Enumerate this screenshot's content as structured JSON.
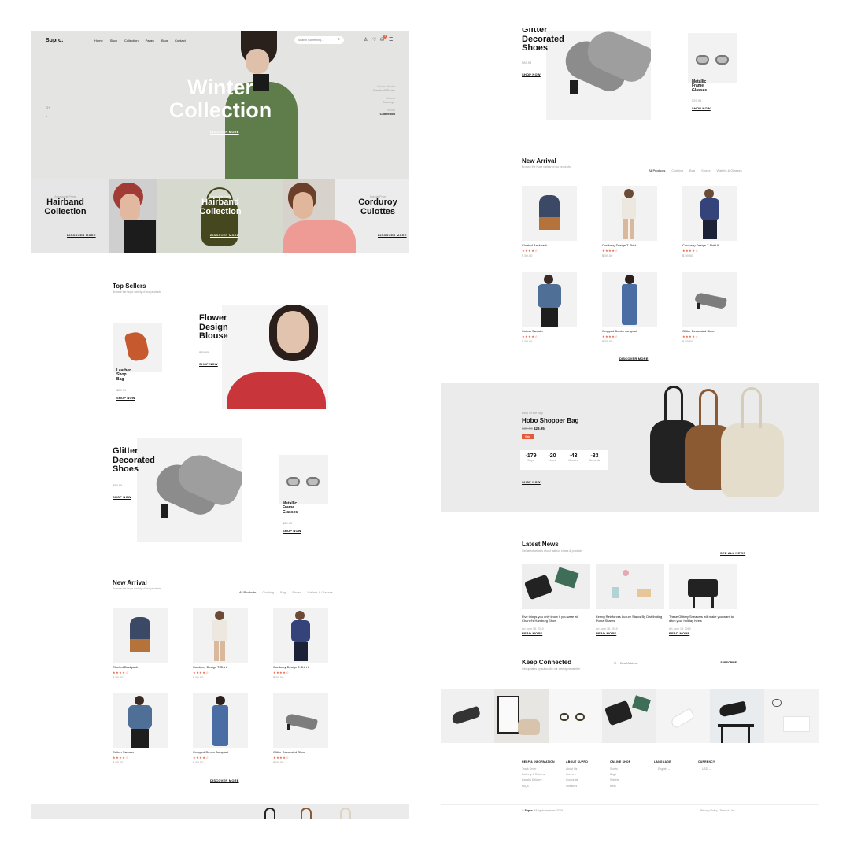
{
  "brand": "Supro.",
  "nav": [
    "Home",
    "Shop",
    "Collection",
    "Pages",
    "Blog",
    "Contact"
  ],
  "search": {
    "placeholder": "Search Something..."
  },
  "cart_count": "0",
  "colors": {
    "accent": "#e25a3a",
    "hero_bg": "#e4e5e3",
    "green_panel": "#d6d9cd",
    "banner_bg": "#ebebeb"
  },
  "hero": {
    "title_line1": "Winter",
    "title_line2": "Collection",
    "cta": "DISCOVER MORE",
    "side": [
      {
        "sub": "Autumn Winter",
        "main": "Baseball Shoes"
      },
      {
        "sub": "Casual",
        "main": "Goodbye"
      },
      {
        "sub": "Winter",
        "main": "Collection"
      }
    ],
    "socials": [
      "twitter-icon",
      "facebook-icon",
      "google-plus-icon",
      "pinterest-icon"
    ]
  },
  "promos": [
    {
      "tag": "Accessorie Prime",
      "line1": "Hairband",
      "line2": "Collection",
      "cta": "DISCOVER MORE"
    },
    {
      "tag": "Accessorie Prime",
      "line1": "Hairband",
      "line2": "Collection",
      "cta": "DISCOVER MORE"
    },
    {
      "tag": "Special Price",
      "line1": "Corduroy",
      "line2": "Culottes",
      "cta": "DISCOVER MORE"
    }
  ],
  "top_sellers": {
    "title": "Top Sellers",
    "sub": "Browse the huge variety of our products",
    "leather": {
      "l1": "Leather",
      "l2": "Shop",
      "l3": "Bag",
      "price": "$89.99",
      "cta": "SHOP NOW"
    },
    "flower": {
      "l1": "Flower",
      "l2": "Design",
      "l3": "Blouse",
      "price": "$89.95",
      "cta": "SHOP NOW"
    },
    "glitter": {
      "l1": "Glitter",
      "l2": "Decorated",
      "l3": "Shoes",
      "price": "$89.95",
      "cta": "SHOP NOW"
    },
    "metallic": {
      "l1": "Metallic",
      "l2": "Frame",
      "l3": "Glasses",
      "price": "$29.95",
      "cta": "SHOP NOW"
    }
  },
  "new_arrival": {
    "title": "New Arrival",
    "sub": "Browse the huge variety of our products",
    "tabs": [
      "All Products",
      "Clothing",
      "Bag",
      "Shoes",
      "Wallets & Glasses"
    ],
    "products": [
      {
        "name": "Clueted Backpack",
        "stars": "★★★★☆",
        "price": "$ 59.00"
      },
      {
        "name": "Corduroy Design T-Shirt",
        "stars": "★★★★☆",
        "price": "$ 59.00"
      },
      {
        "name": "Corduroy Design T-Shirt II",
        "stars": "★★★★☆",
        "price": "$ 59.00"
      },
      {
        "name": "Cotton Sweater",
        "stars": "★★★★☆",
        "price": "$ 59.00"
      },
      {
        "name": "Cropped Denim Jumpsuit",
        "stars": "★★★★☆",
        "price": "$ 59.00"
      },
      {
        "name": "Glitter Decorated Shoe",
        "stars": "★★★★☆",
        "price": "$ 59.00"
      }
    ],
    "cta": "DISCOVER MORE"
  },
  "deal": {
    "tag": "Deal of the day",
    "title": "Hobo Shopper Bag",
    "old_price": "$39.95",
    "price": "$29.95",
    "badge": "Sale",
    "countdown": [
      {
        "n": "-179",
        "l": "Days"
      },
      {
        "n": "-20",
        "l": "Hours"
      },
      {
        "n": "-43",
        "l": "Minutes"
      },
      {
        "n": "-33",
        "l": "Seconds"
      }
    ],
    "cta": "SHOP NOW"
  },
  "news": {
    "title": "Latest News",
    "sub": "Get latest articles about fashion shoes & products",
    "see_all": "SEE ALL NEWS",
    "items": [
      {
        "title": "Five things you only know if you were at Chanel's Hamburg Show",
        "date": "Art   June 18, 2019",
        "cta": "READ MORE"
      },
      {
        "title": "Kering Reinforces Luxury Status By Distributing Puma Shares",
        "date": "Art   June 18, 2019",
        "cta": "READ MORE"
      },
      {
        "title": "These Glittery Sneakers will make you want to ditch your holiday heels",
        "date": "Art   June 18, 2019",
        "cta": "READ MORE"
      }
    ]
  },
  "newsletter": {
    "title": "Keep Connected",
    "sub": "Get updates by subscribe our weekly newsletter",
    "placeholder": "Email Address",
    "cta": "SUBSCRIBE"
  },
  "footer": {
    "cols": [
      {
        "head": "HELP & INFORMATION",
        "items": [
          "Track Order",
          "Delivery & Returns",
          "Kasaba Delivery",
          "FAQs"
        ]
      },
      {
        "head": "ABOUT SUPRO",
        "items": [
          "About Us",
          "Careers",
          "Corporate",
          "Investors"
        ]
      },
      {
        "head": "ONLINE SHOP",
        "items": [
          "Shoes",
          "Bags",
          "Wallets",
          "Belts"
        ]
      },
      {
        "head": "LANGUAGE",
        "items": [
          "English"
        ]
      },
      {
        "head": "CURRENCY",
        "items": [
          "USD"
        ]
      }
    ],
    "copyright_brand": "Supro.",
    "copyright": "All rights reserved 2019",
    "links": [
      "Privacy Policy",
      "Term of Use"
    ]
  }
}
